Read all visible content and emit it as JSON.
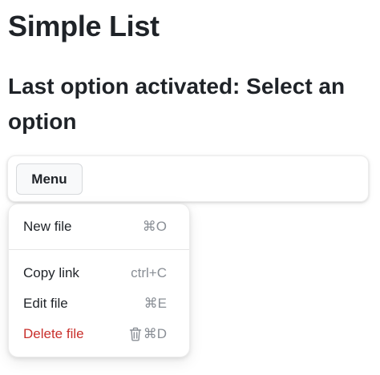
{
  "page": {
    "title": "Simple List",
    "status": "Last option activated: Select an option"
  },
  "toolbar": {
    "menu_label": "Menu"
  },
  "menu": {
    "items": [
      {
        "label": "New file",
        "shortcut": "⌘O"
      },
      {
        "label": "Copy link",
        "shortcut": "ctrl+C"
      },
      {
        "label": "Edit file",
        "shortcut": "⌘E"
      },
      {
        "label": "Delete file",
        "shortcut": "⌘D",
        "icon": "trash-icon"
      }
    ]
  },
  "colors": {
    "text": "#1f2328",
    "muted": "#8a8f96",
    "danger": "#c9302c"
  }
}
